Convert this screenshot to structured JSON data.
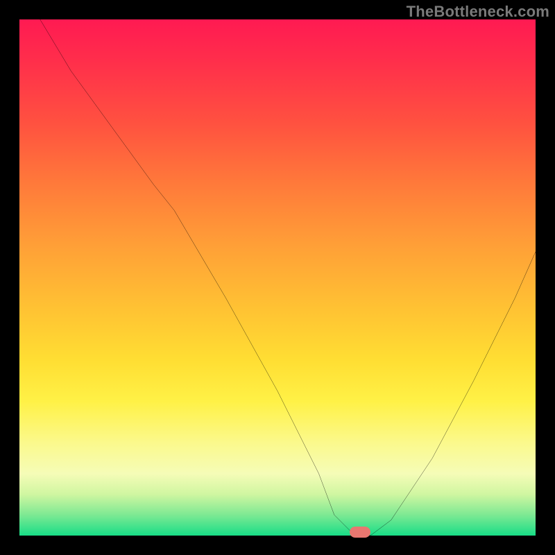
{
  "watermark": "TheBottleneck.com",
  "colors": {
    "curve_stroke": "#000000",
    "marker_fill": "#e87770",
    "plot_border": "#000000"
  },
  "chart_data": {
    "type": "line",
    "title": "",
    "xlabel": "",
    "ylabel": "",
    "xlim": [
      0,
      100
    ],
    "ylim": [
      0,
      100
    ],
    "grid": false,
    "series": [
      {
        "name": "bottleneck-curve",
        "x": [
          4,
          10,
          18,
          26,
          30,
          40,
          50,
          58,
          61,
          64,
          68,
          72,
          80,
          88,
          96,
          100
        ],
        "values": [
          100,
          90,
          79,
          68,
          63,
          46,
          28,
          12,
          4,
          1,
          0,
          3,
          15,
          30,
          46,
          55
        ]
      }
    ],
    "annotations": [
      {
        "name": "optimal-marker",
        "x": 66,
        "y": 0.7
      }
    ],
    "gradient_stops": [
      {
        "pos": 0,
        "color": "#ff1a52"
      },
      {
        "pos": 20,
        "color": "#ff5140"
      },
      {
        "pos": 44,
        "color": "#ffa037"
      },
      {
        "pos": 66,
        "color": "#ffde33"
      },
      {
        "pos": 88,
        "color": "#f5fcb7"
      },
      {
        "pos": 100,
        "color": "#18dd87"
      }
    ]
  }
}
